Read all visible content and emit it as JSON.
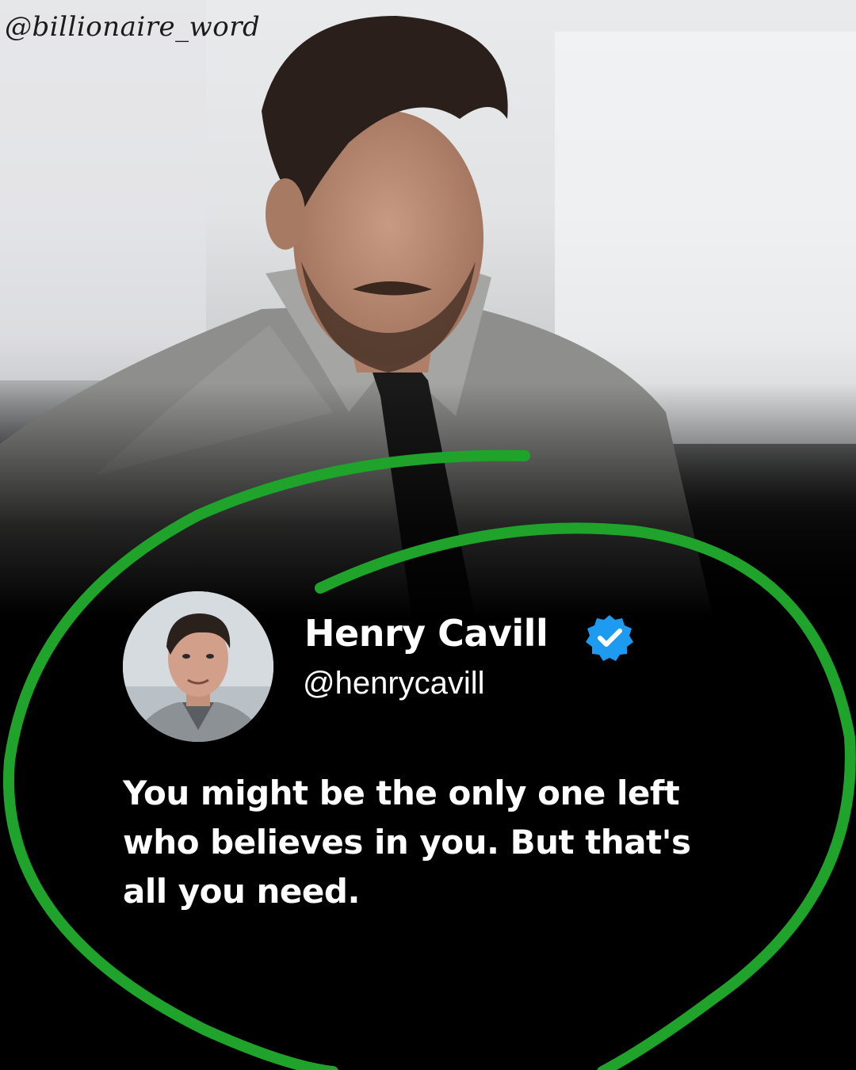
{
  "watermark": "@billionaire_word",
  "tweet": {
    "display_name": "Henry Cavill",
    "handle": "@henrycavill",
    "verified": true,
    "text": "You might be the only one left who believes in you. But that's all you need."
  },
  "icons": {
    "verified": "verified-badge-icon",
    "avatar": "profile-photo"
  },
  "colors": {
    "background": "#000000",
    "accent_green": "#1fa32b",
    "verified_blue": "#1d9bf0",
    "text": "#ffffff"
  }
}
